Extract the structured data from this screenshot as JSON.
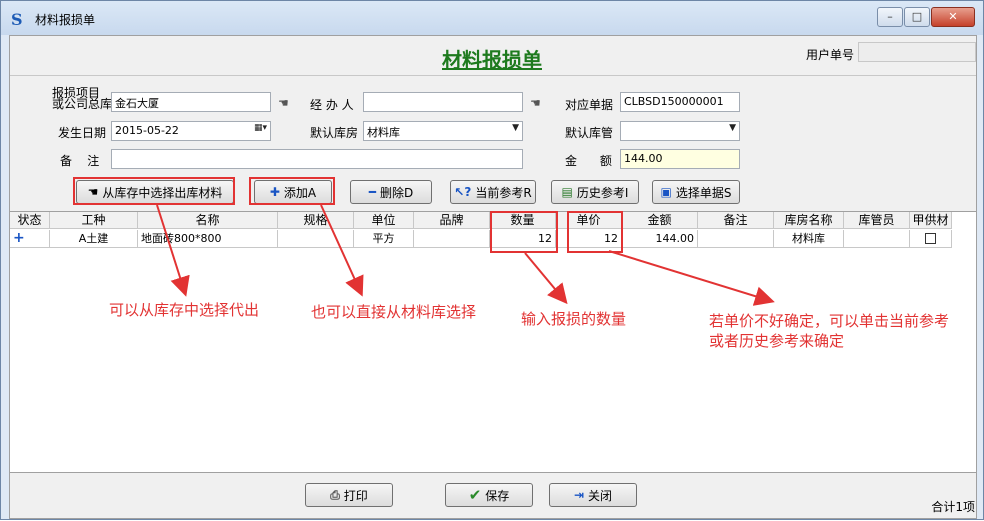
{
  "window": {
    "title": "材料报损单",
    "min": "–",
    "max": "□",
    "close": "✕"
  },
  "header": {
    "form_title": "材料报损单",
    "user_no_label": "用户单号",
    "user_no_value": ""
  },
  "form": {
    "project_label_1": "报损项目",
    "project_label_2": "或公司总库",
    "project_value": "金石大厦",
    "handler_label": "经 办 人",
    "handler_value": "",
    "ref_doc_label": "对应单据",
    "ref_doc_value": "CLBSD150000001",
    "date_label": "发生日期",
    "date_value": "2015-05-22",
    "warehouse_label": "默认库房",
    "warehouse_value": "材料库",
    "keeper_label": "默认库管",
    "keeper_value": "",
    "remark_label": "备    注",
    "remark_value": "",
    "amount_label": "金      额",
    "amount_value": "144.00"
  },
  "toolbar": {
    "select_from_stock": "从库存中选择出库材料",
    "add": "添加A",
    "delete": "删除D",
    "current_ref": "当前参考R",
    "history_ref": "历史参考I",
    "select_doc": "选择单据S"
  },
  "grid": {
    "columns": [
      "状态",
      "工种",
      "名称",
      "规格",
      "单位",
      "品牌",
      "数量",
      "单价",
      "金额",
      "备注",
      "库房名称",
      "库管员",
      "甲供材"
    ],
    "rows": [
      {
        "status": "+",
        "trade": "A土建",
        "name": "地面砖800*800",
        "spec": "",
        "unit": "平方",
        "brand": "",
        "qty": "12",
        "price": "12",
        "amount": "144.00",
        "remark": "",
        "warehouse": "材料库",
        "keeper": "",
        "owner_supplied": false
      }
    ]
  },
  "annotations": {
    "a1": "可以从库存中选择代出",
    "a2": "也可以直接从材料库选择",
    "a3": "输入报损的数量",
    "a4_line1": "若单价不好确定，可以单击当前参考",
    "a4_line2": "或者历史参考来确定"
  },
  "footer": {
    "print": "打印",
    "save": "保存",
    "close": "关闭",
    "total": "合计1项"
  },
  "colors": {
    "annotation_red": "#e23333",
    "title_green": "#1e7a1e",
    "amount_bg": "#ffffe1"
  }
}
